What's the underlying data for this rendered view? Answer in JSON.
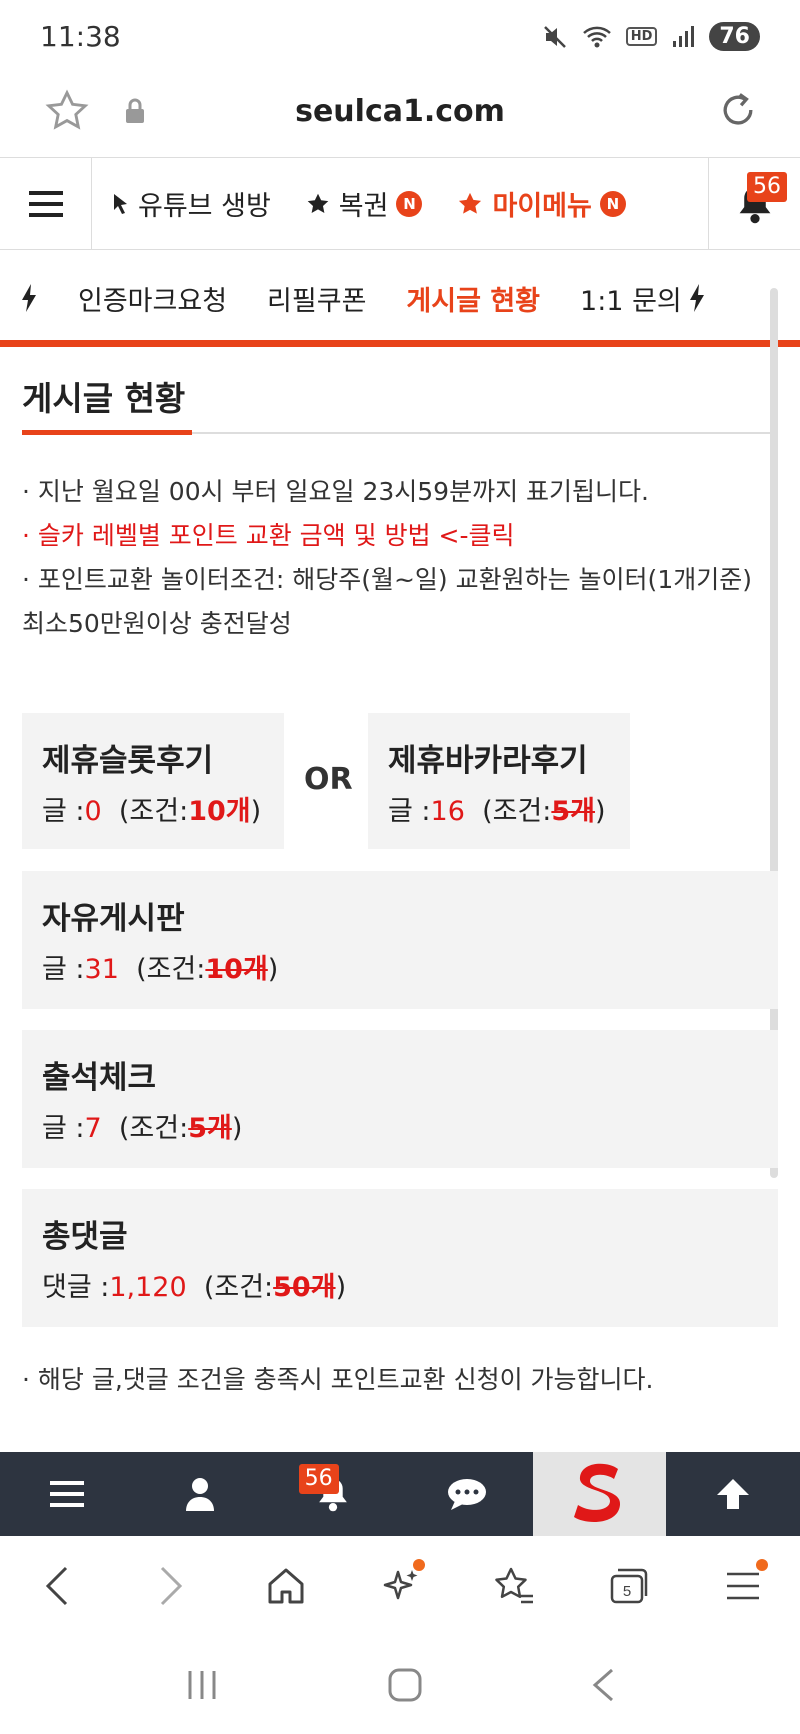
{
  "status_bar": {
    "time": "11:38",
    "hd": "HD",
    "battery": "76"
  },
  "url_bar": {
    "domain": "seulca1.com"
  },
  "site_menu": {
    "items": [
      {
        "label": "유튜브 생방",
        "icon": "cursor-icon"
      },
      {
        "label": "복권",
        "icon": "star-icon",
        "badge": "N"
      },
      {
        "label": "마이메뉴",
        "icon": "star-icon",
        "badge": "N"
      }
    ],
    "bell_count": "56"
  },
  "sub_nav": {
    "items": [
      {
        "label": "인증마크요청"
      },
      {
        "label": "리필쿠폰"
      },
      {
        "label": "게시글 현황"
      },
      {
        "label": "1:1 문의"
      }
    ]
  },
  "page": {
    "title": "게시글 현황",
    "notes": [
      "· 지난 월요일 00시 부터 일요일 23시59분까지 표기됩니다.",
      "· 슬카 레벨별 포인트 교환 금액 및 방법 <-클릭",
      "· 포인트교환 놀이터조건: 해당주(월~일) 교환원하는 놀이터(1개기준) 최소50만원이상 충전달성"
    ],
    "or_label": "OR",
    "footer_note": "· 해당 글,댓글 조건을 충족시 포인트교환 신청이 가능합니다."
  },
  "boards": {
    "slot": {
      "title": "제휴슬롯후기",
      "count_label": "글 :",
      "count": "0",
      "cond_open": "(조건:",
      "cond": "10개",
      "cond_close": ")"
    },
    "baccarat": {
      "title": "제휴바카라후기",
      "count_label": "글 :",
      "count": "16",
      "cond_open": "(조건:",
      "cond": "5개",
      "cond_close": ")"
    },
    "free": {
      "title": "자유게시판",
      "count_label": "글 :",
      "count": "31",
      "cond_open": "(조건:",
      "cond": "10개",
      "cond_close": ")"
    },
    "attendance": {
      "title": "출석체크",
      "count_label": "글 :",
      "count": "7",
      "cond_open": "(조건:",
      "cond": "5개",
      "cond_close": ")"
    },
    "comments": {
      "title": "총댓글",
      "count_label": "댓글 :",
      "count": "1,120",
      "cond_open": "(조건:",
      "cond": "50개",
      "cond_close": ")"
    }
  },
  "site_bottom": {
    "bell_count": "56"
  },
  "browser_bar": {
    "tab_count": "5"
  },
  "colors": {
    "accent": "#e8431a",
    "red": "#e01818",
    "dark_bar": "#2d3440"
  }
}
